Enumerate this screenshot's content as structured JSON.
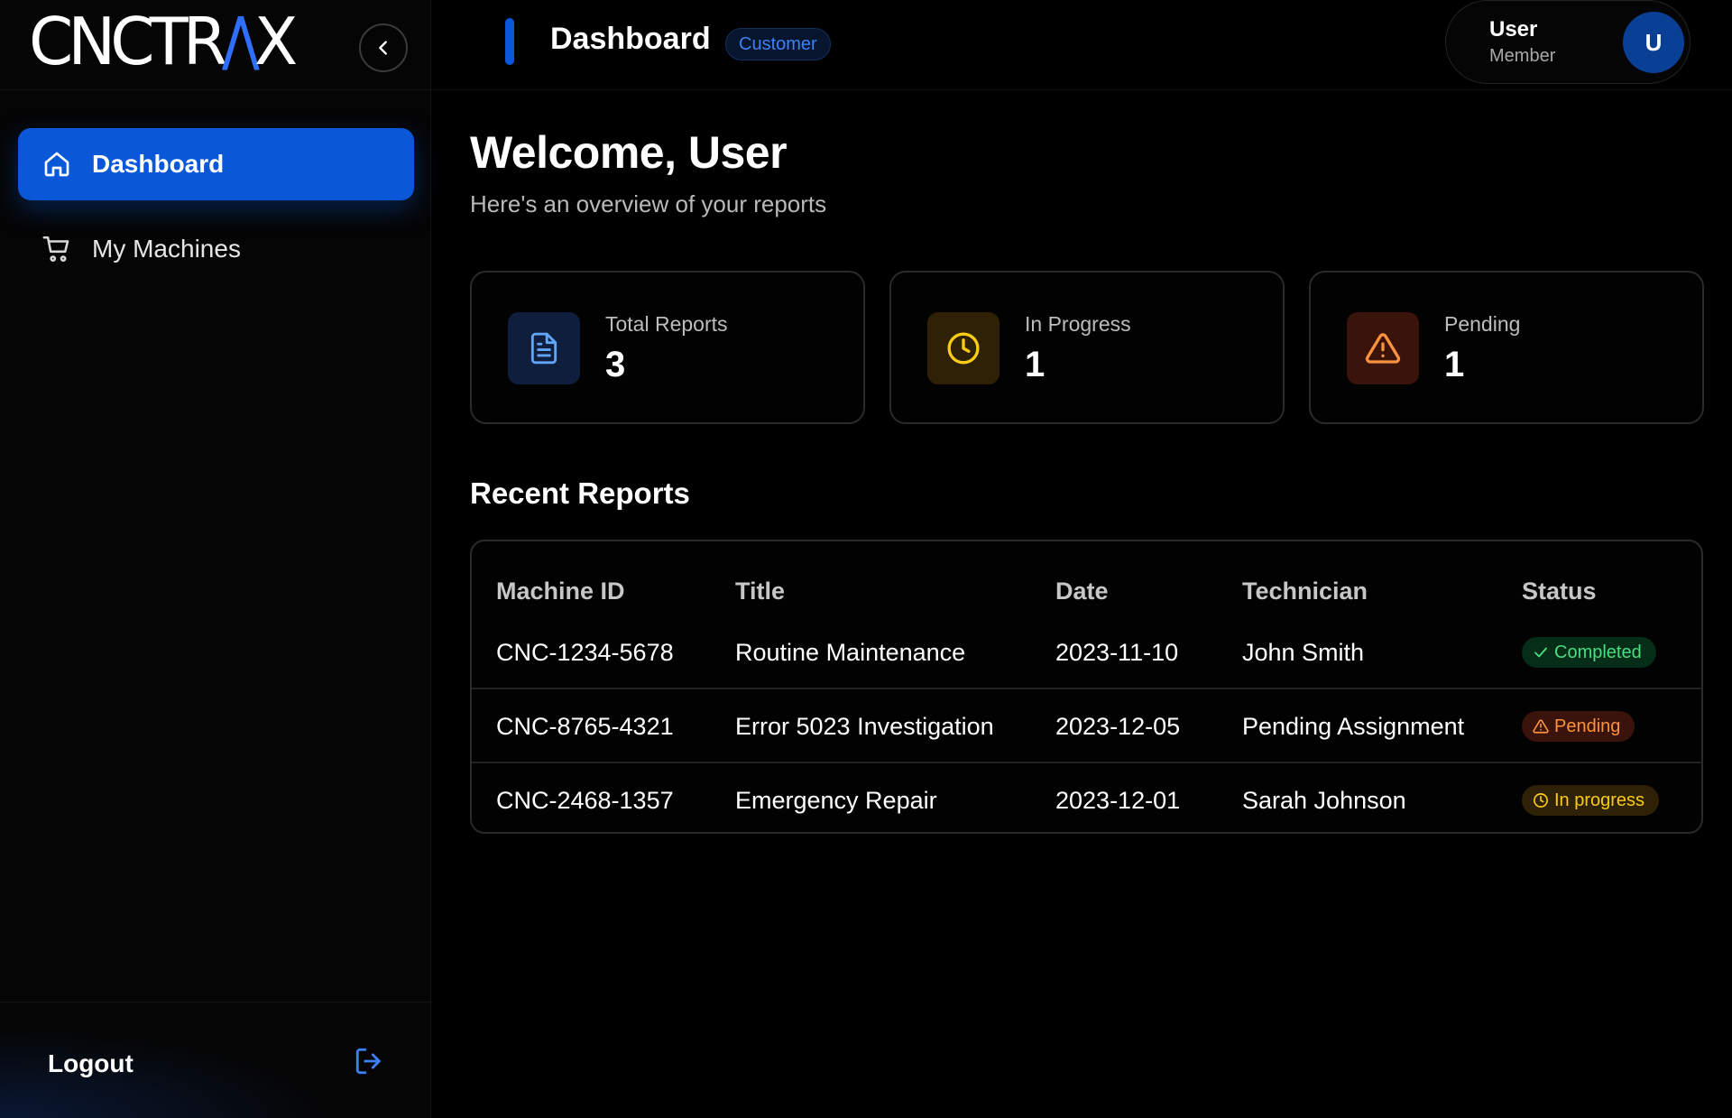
{
  "brand": {
    "logo_main": "CNCTR",
    "logo_accent": "/\\",
    "logo_end": "X"
  },
  "sidebar": {
    "items": [
      {
        "label": "Dashboard",
        "icon": "home-icon",
        "active": true
      },
      {
        "label": "My Machines",
        "icon": "cart-icon",
        "active": false
      }
    ],
    "logout_label": "Logout"
  },
  "header": {
    "title": "Dashboard",
    "role_badge": "Customer",
    "user_name": "User",
    "user_role": "Member",
    "avatar_initial": "U"
  },
  "main": {
    "welcome": "Welcome, User",
    "subtitle": "Here's an overview of your reports",
    "stats": [
      {
        "label": "Total Reports",
        "value": "3",
        "icon": "document-icon",
        "color": "#60a5fa",
        "bg": "#0f1e3d"
      },
      {
        "label": "In Progress",
        "value": "1",
        "icon": "clock-icon",
        "color": "#facc15",
        "bg": "#2e2106"
      },
      {
        "label": "Pending",
        "value": "1",
        "icon": "warning-icon",
        "color": "#fb923c",
        "bg": "#3a130b"
      }
    ],
    "section_title": "Recent Reports",
    "table": {
      "columns": [
        "Machine ID",
        "Title",
        "Date",
        "Technician",
        "Status"
      ],
      "rows": [
        {
          "machine_id": "CNC-1234-5678",
          "title": "Routine Maintenance",
          "date": "2023-11-10",
          "technician": "John Smith",
          "status": "Completed"
        },
        {
          "machine_id": "CNC-8765-4321",
          "title": "Error 5023 Investigation",
          "date": "2023-12-05",
          "technician": "Pending Assignment",
          "status": "Pending"
        },
        {
          "machine_id": "CNC-2468-1357",
          "title": "Emergency Repair",
          "date": "2023-12-01",
          "technician": "Sarah Johnson",
          "status": "In progress"
        }
      ]
    }
  },
  "colors": {
    "accent": "#0a58d8",
    "completed": "#4ade80",
    "pending": "#fb923c",
    "in_progress": "#facc15"
  }
}
